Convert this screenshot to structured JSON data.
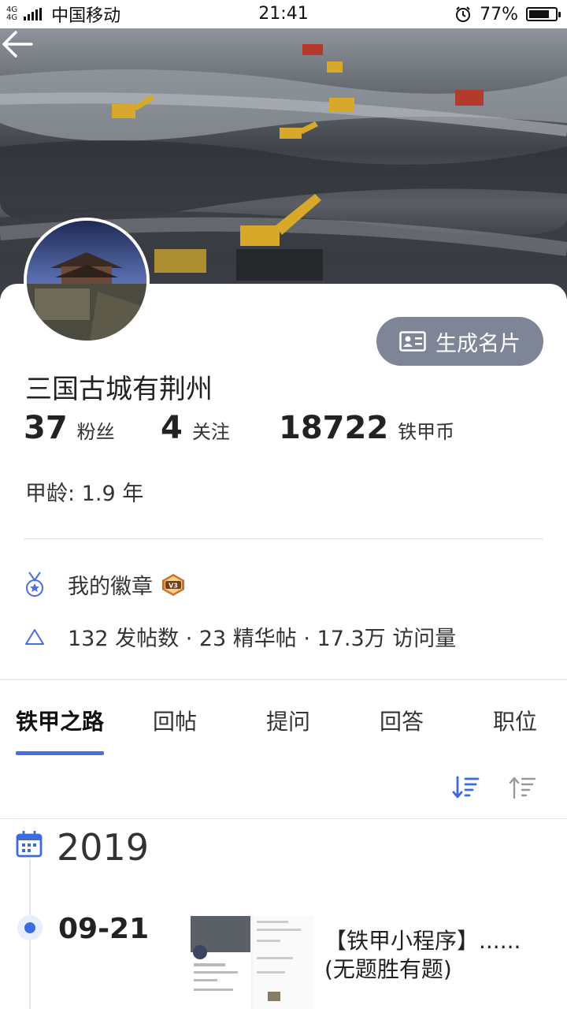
{
  "status_bar": {
    "network": "4G",
    "carrier": "中国移动",
    "time": "21:41",
    "battery": "77%",
    "battery_level": 0.77,
    "icons": [
      "signal-icon",
      "alarm-icon",
      "battery-icon"
    ]
  },
  "header": {
    "back_icon": "arrow-left-icon"
  },
  "profile": {
    "card_button_label": "生成名片",
    "username": "三国古城有荆州",
    "stats": [
      {
        "value": "37",
        "label": "粉丝"
      },
      {
        "value": "4",
        "label": "关注"
      },
      {
        "value": "18722",
        "label": "铁甲币"
      }
    ],
    "age": "甲龄: 1.9 年",
    "badges_label": "我的徽章",
    "badge_level": "V3",
    "activity_summary": "132 发帖数 · 23 精华帖 · 17.3万 访问量"
  },
  "tabs": [
    {
      "label": "铁甲之路",
      "active": true
    },
    {
      "label": "回帖"
    },
    {
      "label": "提问"
    },
    {
      "label": "回答"
    },
    {
      "label": "职位"
    }
  ],
  "timeline": {
    "year": "2019",
    "entries": [
      {
        "date": "09-21",
        "title": "【铁甲小程序】...... (无题胜有题)"
      }
    ]
  },
  "colors": {
    "accent": "#3b6bdf",
    "card_button_bg": "#7d8597",
    "tab_underline": "#4a6fdc"
  }
}
